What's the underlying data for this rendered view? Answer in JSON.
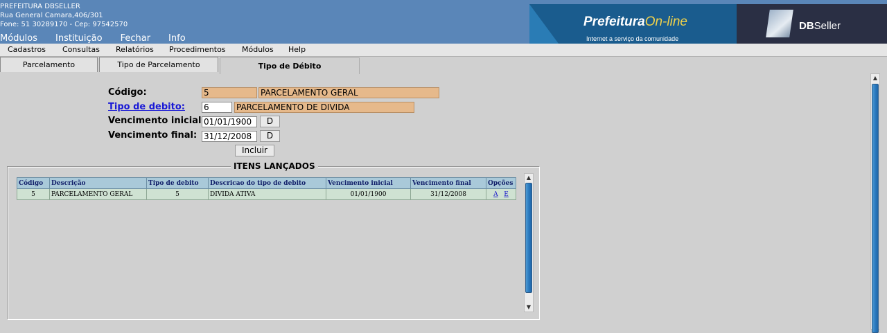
{
  "header": {
    "org": "PREFEITURA DBSELLER",
    "address": "Rua General Camara,406/301",
    "phone": "Fone: 51 30289170  -  Cep: 97542570",
    "menu": [
      "Módulos",
      "Instituição",
      "Fechar",
      "Info"
    ],
    "logo_prefeitura": "Prefeitura",
    "logo_online": "On-line",
    "logo_tagline": "Internet a serviço da comunidade",
    "logo_db": "DB",
    "logo_seller": "Seller"
  },
  "menubar": [
    "Cadastros",
    "Consultas",
    "Relatórios",
    "Procedimentos",
    "Módulos",
    "Help"
  ],
  "tabs": [
    "Parcelamento",
    "Tipo de Parcelamento",
    "Tipo de Débito"
  ],
  "form": {
    "codigo_label": "Código:",
    "codigo_value": "5",
    "codigo_desc": "PARCELAMENTO GERAL",
    "tipo_label": "Tipo de debito:",
    "tipo_value": "6",
    "tipo_desc": "PARCELAMENTO DE DIVIDA",
    "venc_ini_label": "Vencimento inicial:",
    "venc_ini_value": "01/01/1900",
    "venc_fin_label": "Vencimento final:",
    "venc_fin_value": "31/12/2008",
    "date_btn": "D",
    "incluir": "Incluir"
  },
  "items": {
    "legend": "ITENS LANÇADOS",
    "columns": [
      "Código",
      "Descrição",
      "Tipo de debito",
      "Descricao do tipo de debito",
      "Vencimento inicial",
      "Vencimento final",
      "Opções"
    ],
    "rows": [
      [
        "5",
        "PARCELAMENTO GERAL",
        "5",
        "DIVIDA ATIVA",
        "01/01/1900",
        "31/12/2008"
      ]
    ],
    "action_a": "A",
    "action_e": "E"
  }
}
